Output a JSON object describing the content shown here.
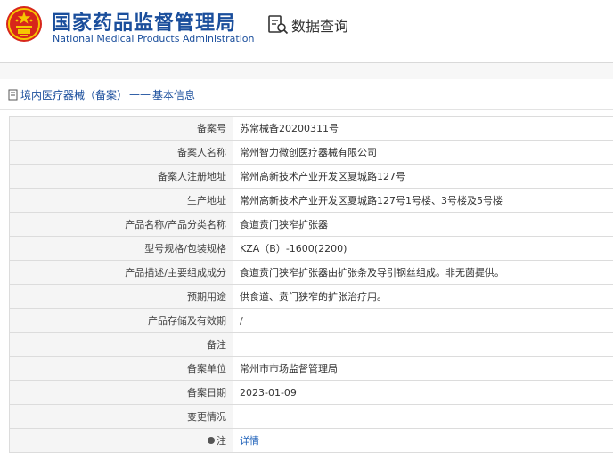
{
  "header": {
    "org_name_cn": "国家药品监督管理局",
    "org_name_en": "National Medical Products Administration",
    "query_label": "数据查询"
  },
  "breadcrumb": {
    "section": "境内医疗器械（备案）",
    "separator": "——",
    "page": "基本信息"
  },
  "rows": [
    {
      "label": "备案号",
      "value": "苏常械备20200311号"
    },
    {
      "label": "备案人名称",
      "value": "常州智力微创医疗器械有限公司"
    },
    {
      "label": "备案人注册地址",
      "value": "常州高新技术产业开发区夏城路127号"
    },
    {
      "label": "生产地址",
      "value": "常州高新技术产业开发区夏城路127号1号楼、3号楼及5号楼"
    },
    {
      "label": "产品名称/产品分类名称",
      "value": "食道贲门狭窄扩张器"
    },
    {
      "label": "型号规格/包装规格",
      "value": "KZA（B）-1600(2200)"
    },
    {
      "label": "产品描述/主要组成成分",
      "value": "食道贲门狭窄扩张器由扩张条及导引钢丝组成。非无菌提供。"
    },
    {
      "label": "预期用途",
      "value": "供食道、贲门狭窄的扩张治疗用。"
    },
    {
      "label": "产品存储及有效期",
      "value": "/"
    },
    {
      "label": "备注",
      "value": ""
    },
    {
      "label": "备案单位",
      "value": "常州市市场监督管理局"
    },
    {
      "label": "备案日期",
      "value": "2023-01-09"
    },
    {
      "label": "变更情况",
      "value": ""
    }
  ],
  "note_row": {
    "label": "注",
    "link": "详情"
  },
  "colors": {
    "brand_blue": "#1a4e9c",
    "emblem_red": "#d7261b",
    "emblem_gold": "#f6c700"
  }
}
